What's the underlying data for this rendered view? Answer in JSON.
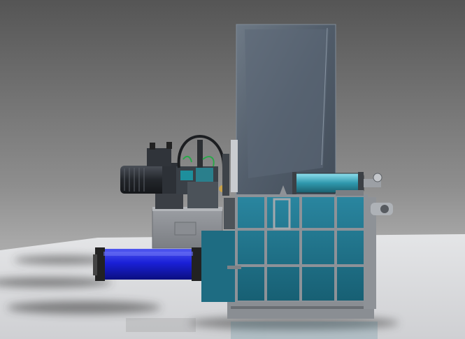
{
  "scene": {
    "subject": "hydraulic-baler-render",
    "colors": {
      "background_top": "#5a5a5a",
      "background_mid": "#8c8c8c",
      "floor": "#d9dadc",
      "hopper_glass": "#566271",
      "teal_panel": "#1f6f86",
      "frame_gray": "#8a8d92",
      "cylinder_blue": "#1a1fd6",
      "cylinder_cyan": "#3aa3b5",
      "motor_dark": "#2c2f34"
    }
  }
}
